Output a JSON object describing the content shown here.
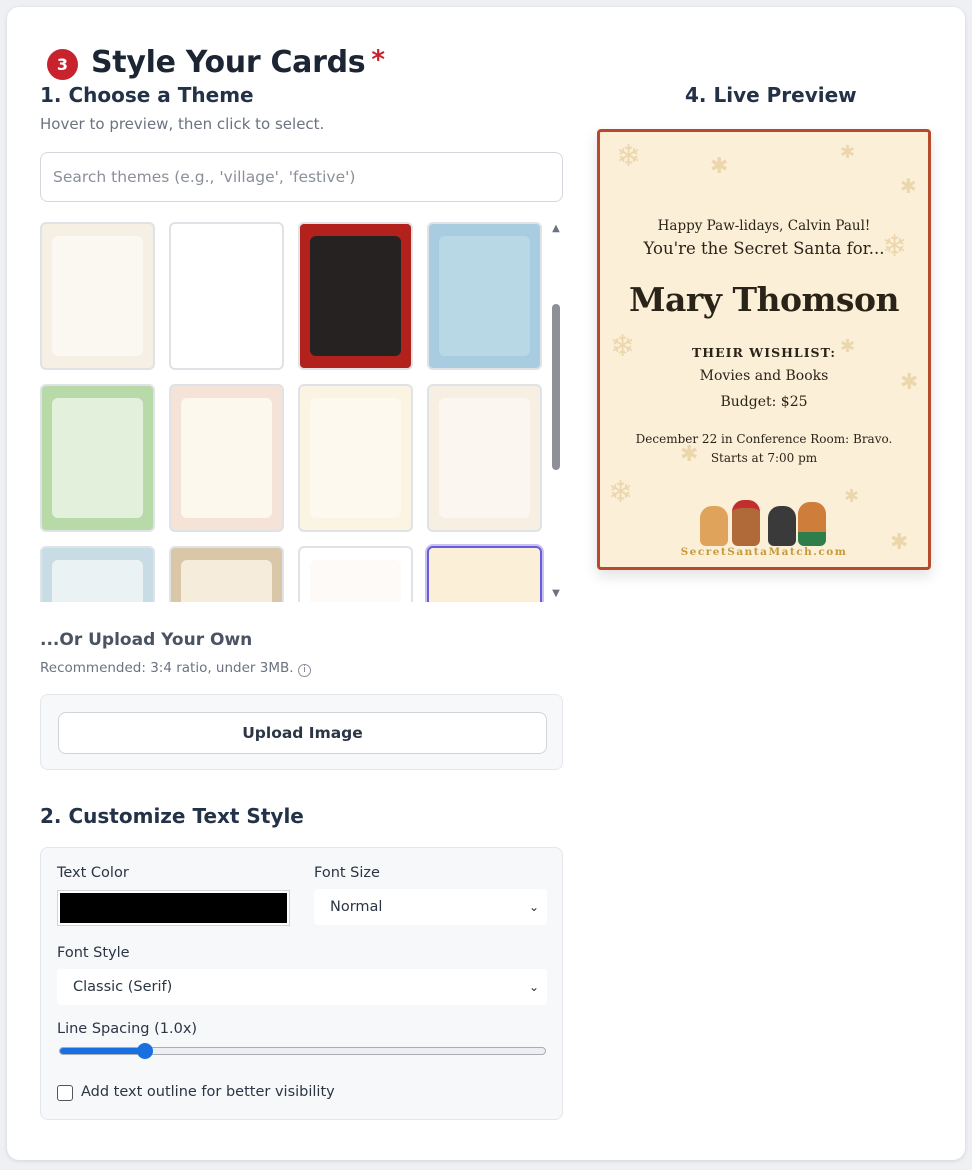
{
  "section": {
    "step_number": "3",
    "title": "Style Your Cards",
    "required_mark": "*"
  },
  "theme": {
    "heading": "1. Choose a Theme",
    "hint": "Hover to preview, then click to select.",
    "search_placeholder": "Search themes (e.g., 'village', 'festive')",
    "thumbnails": [
      {
        "name": "holly-gift-exchange",
        "bg": "#f6efe4",
        "inner": "#fbf8f2"
      },
      {
        "name": "santa-border",
        "bg": "#ffffff",
        "inner": "#ffffff"
      },
      {
        "name": "dark-red-floral",
        "bg": "#b3211c",
        "inner": "#252221"
      },
      {
        "name": "snowy-village",
        "bg": "#a9cde0",
        "inner": "#b9d8e6"
      },
      {
        "name": "green-elves",
        "bg": "#b8d9a8",
        "inner": "#e2f0dc"
      },
      {
        "name": "north-pole",
        "bg": "#f5e3d8",
        "inner": "#fdf8ee"
      },
      {
        "name": "gold-stars-trees",
        "bg": "#fbf4e3",
        "inner": "#fdf9ee"
      },
      {
        "name": "gold-ornaments",
        "bg": "#f7efe2",
        "inner": "#fbf6ef"
      },
      {
        "name": "frosty-blue",
        "bg": "#c8dce6",
        "inner": "#eaf2f4"
      },
      {
        "name": "kraft-gold",
        "bg": "#d9c7a7",
        "inner": "#f6ecdb"
      },
      {
        "name": "red-baubles",
        "bg": "#ffffff",
        "inner": "#fdfaf7"
      },
      {
        "name": "cream-gold-snow",
        "bg": "#fbefd8",
        "inner": "#fbefd8"
      }
    ],
    "selected_index": 11
  },
  "upload": {
    "heading": "...Or Upload Your Own",
    "hint": "Recommended: 3:4 ratio, under 3MB.",
    "info_icon": "info-icon",
    "button_label": "Upload Image"
  },
  "text_style": {
    "heading": "2. Customize Text Style",
    "text_color_label": "Text Color",
    "text_color": "#000000",
    "font_size_label": "Font Size",
    "font_size_value": "Normal",
    "font_style_label": "Font Style",
    "font_style_value": "Classic (Serif)",
    "line_spacing_label": "Line Spacing (1.0x)",
    "line_spacing_value": 1.0,
    "outline_label": "Add text outline for better visibility",
    "outline_checked": false
  },
  "preview": {
    "heading": "4. Live Preview",
    "greeting": "Happy Paw-lidays, Calvin Paul!",
    "intro": "You're the Secret Santa for...",
    "recipient": "Mary Thomson",
    "wishlist_title": "THEIR WISHLIST:",
    "wishlist": "Movies and Books",
    "budget": "Budget: $25",
    "event_line1": "December 22 in Conference Room: Bravo.",
    "event_line2": "Starts at 7:00 pm",
    "footer": "SecretSantaMatch.com",
    "border_color": "#b64a2c",
    "background_color": "#fbefd8"
  }
}
